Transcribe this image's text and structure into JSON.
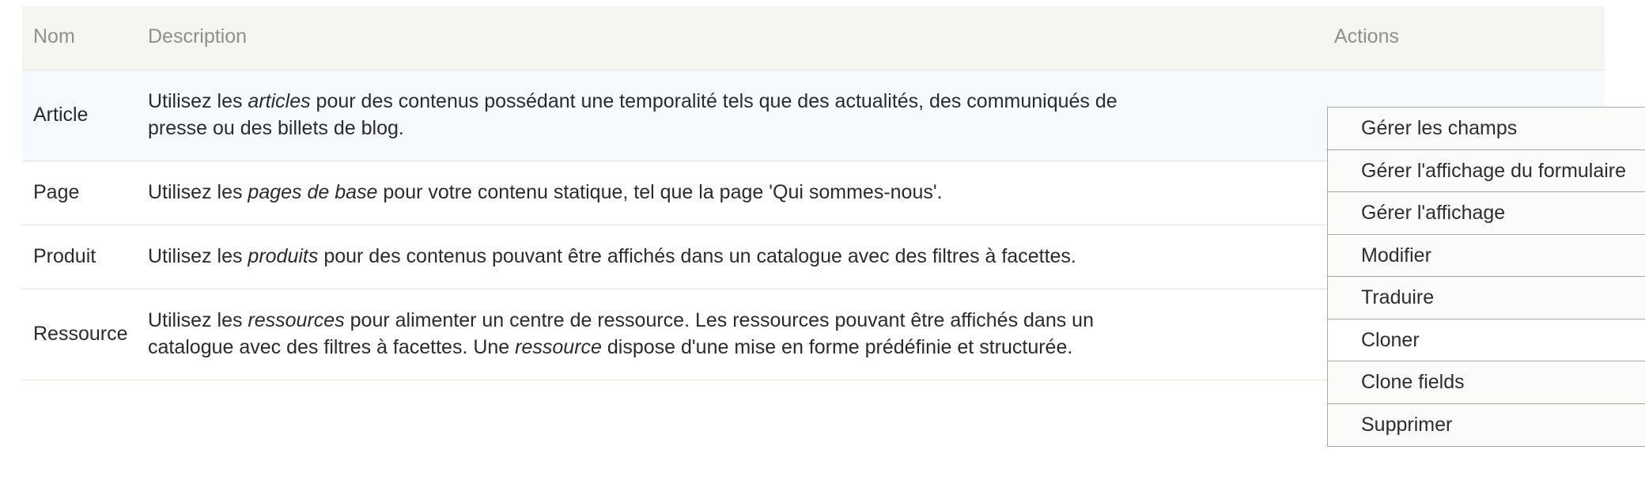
{
  "table": {
    "columns": [
      {
        "key": "nom",
        "label": "Nom"
      },
      {
        "key": "description",
        "label": "Description"
      },
      {
        "key": "actions",
        "label": "Actions"
      }
    ],
    "rows": [
      {
        "nom": "Article",
        "description_lines": [
          "Utilisez les |articles| pour des contenus possédant une temporalité tels que des actualités, des communiqués de",
          "presse ou des billets de blog."
        ],
        "highlighted": true
      },
      {
        "nom": "Page",
        "description_lines": [
          "Utilisez les |pages de base| pour votre contenu statique, tel que la page 'Qui sommes-nous'."
        ],
        "highlighted": false
      },
      {
        "nom": "Produit",
        "description_lines": [
          "Utilisez les |produits| pour des contenus pouvant être affichés dans un catalogue avec des filtres à facettes."
        ],
        "highlighted": false
      },
      {
        "nom": "Ressource",
        "description_lines": [
          "Utilisez les |ressources| pour alimenter un centre de ressource. Les ressources pouvant être affichés dans un",
          "catalogue avec des filtres à facettes. Une |ressource| dispose d'une mise en forme prédéfinie et structurée."
        ],
        "highlighted": false
      }
    ]
  },
  "actions_dropdown": {
    "open": true,
    "items": [
      {
        "label": "Gérer les champs",
        "hover": false
      },
      {
        "label": "Gérer l'affichage du formulaire",
        "hover": false
      },
      {
        "label": "Gérer l'affichage",
        "hover": false
      },
      {
        "label": "Modifier",
        "hover": false
      },
      {
        "label": "Traduire",
        "hover": false
      },
      {
        "label": "Cloner",
        "hover": true
      },
      {
        "label": "Clone fields",
        "hover": false
      },
      {
        "label": "Supprimer",
        "hover": false
      }
    ]
  },
  "colors": {
    "header_bg": "#f6f5f0",
    "header_text": "#8f8f8b",
    "row_highlight_bg": "#f6fafe",
    "row_bg": "#ffffff",
    "row_border": "#e3e1da",
    "body_text": "#2b2b2b",
    "menu_bg": "#fbfbfa",
    "menu_hover_bg": "#ffffff",
    "menu_border": "#a8a8a2",
    "menu_text": "#2d2d2d"
  }
}
